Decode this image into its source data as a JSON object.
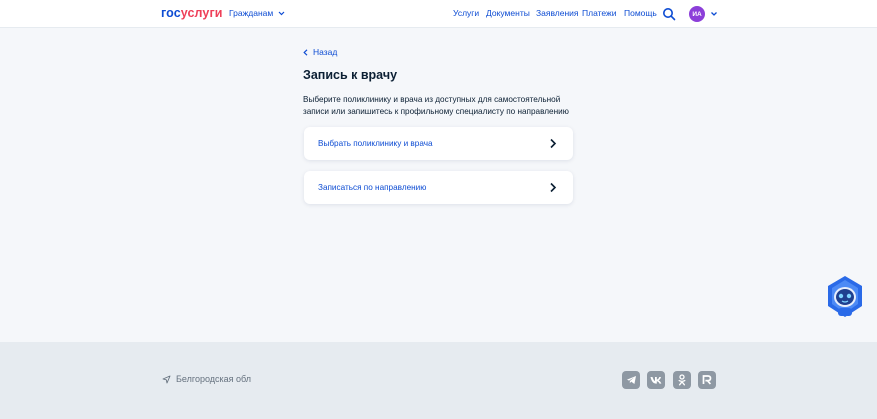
{
  "header": {
    "logo_part1": "гос",
    "logo_part2": "услуги",
    "audience_label": "Гражданам",
    "nav": [
      "Услуги",
      "Документы",
      "Заявления",
      "Платежи",
      "Помощь"
    ],
    "avatar_initials": "ИА"
  },
  "main": {
    "back_label": "Назад",
    "title": "Запись к врачу",
    "description": "Выберите поликлинику и врача из доступных для самостоятельной записи или запишитесь к профильному специалисту по направлению",
    "options": [
      {
        "label": "Выбрать поликлинику и врача"
      },
      {
        "label": "Записаться по направлению"
      }
    ]
  },
  "footer": {
    "region": "Белгородская обл",
    "socials": [
      "telegram-icon",
      "vk-icon",
      "odnoklassniki-icon",
      "rutube-icon"
    ]
  },
  "colors": {
    "accent": "#0d4cd3",
    "brand_red": "#ee3f58",
    "avatar": "#8c3fd9",
    "footer_bg": "#e6ebf0"
  }
}
